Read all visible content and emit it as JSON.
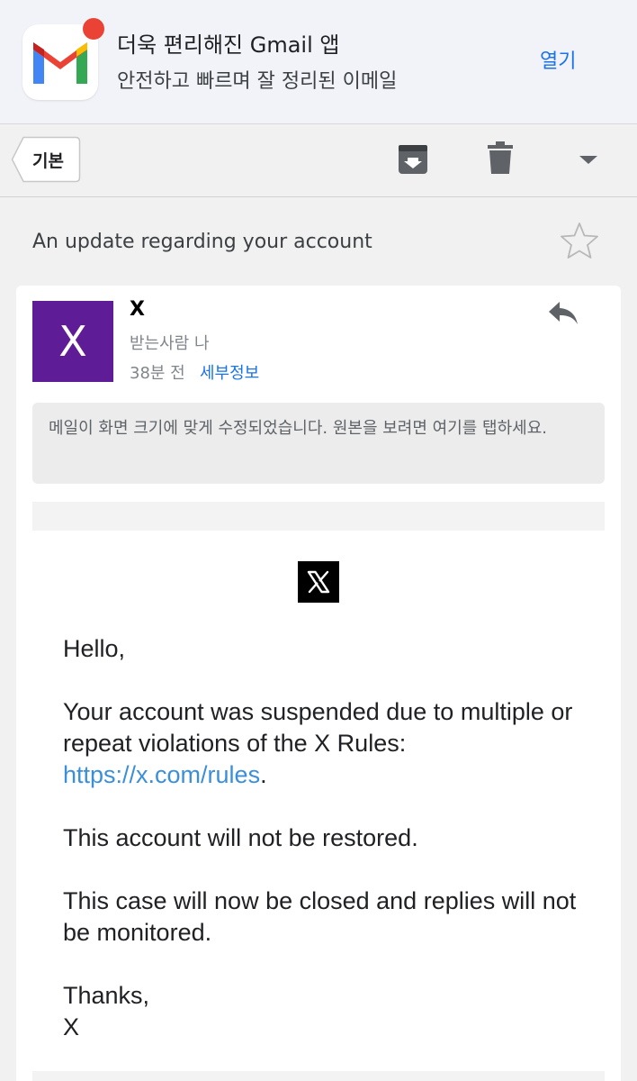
{
  "banner": {
    "title": "더욱 편리해진 Gmail 앱",
    "subtitle": "안전하고 빠르며 잘 정리된 이메일",
    "open_label": "열기",
    "app_icon": "gmail-icon",
    "dot_color": "#ea4335"
  },
  "toolbar": {
    "back_label": "기본",
    "icons": [
      "archive-icon",
      "trash-icon",
      "chevron-down-icon"
    ]
  },
  "email": {
    "subject": "An update regarding your account",
    "sender_initial": "X",
    "sender_name": "X",
    "recipient": "받는사람 나",
    "time": "38분 전",
    "details_label": "세부정보",
    "avatar_color": "#5e1c96",
    "notice": "메일이 화면 크기에 맞게 수정되었습니다. 원본을 보려면 여기를 탭하세요.",
    "body": {
      "greeting": "Hello,",
      "para1": "Your account was suspended due to multiple or repeat violations of the X Rules:",
      "rules_link": "https://x.com/rules",
      "para1_end": ".",
      "para2": "This account will not be restored.",
      "para3": "This case will now be closed and replies will not be monitored.",
      "signoff": "Thanks,",
      "signature": "X"
    }
  },
  "colors": {
    "link": "#1a73e8",
    "body_link": "#3b8fd9"
  }
}
